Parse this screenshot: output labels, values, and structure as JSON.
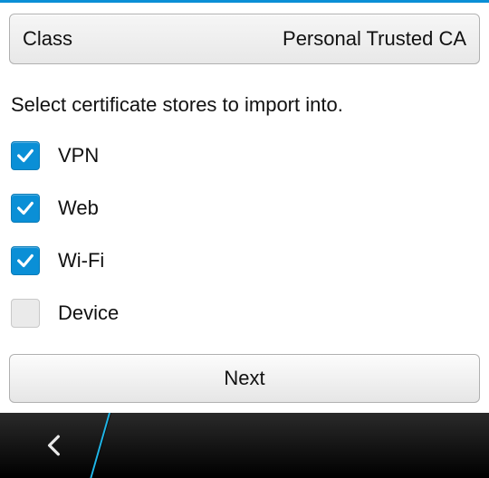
{
  "classRow": {
    "label": "Class",
    "value": "Personal Trusted CA"
  },
  "instruction": "Select certificate stores to import into.",
  "options": [
    {
      "label": "VPN",
      "checked": true
    },
    {
      "label": "Web",
      "checked": true
    },
    {
      "label": "Wi-Fi",
      "checked": true
    },
    {
      "label": "Device",
      "checked": false
    }
  ],
  "nextLabel": "Next",
  "colors": {
    "accent": "#0a8fd6"
  }
}
